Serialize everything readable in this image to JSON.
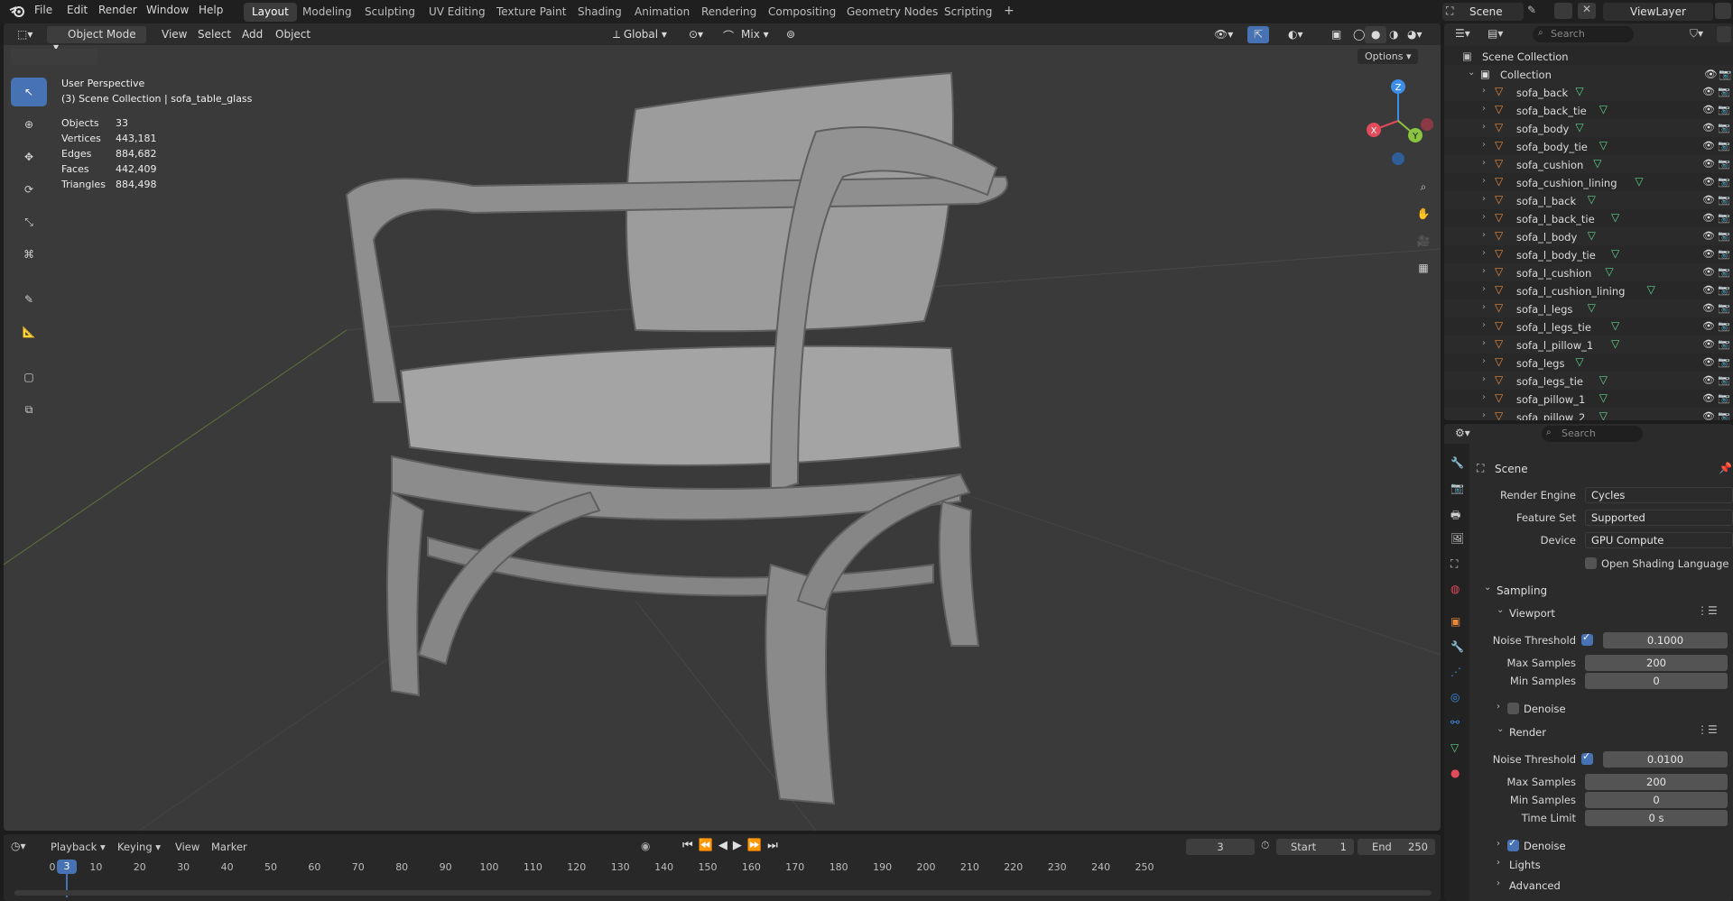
{
  "menubar": {
    "menus": [
      "File",
      "Edit",
      "Render",
      "Window",
      "Help"
    ],
    "workspaces": [
      "Layout",
      "Modeling",
      "Sculpting",
      "UV Editing",
      "Texture Paint",
      "Shading",
      "Animation",
      "Rendering",
      "Compositing",
      "Geometry Nodes",
      "Scripting"
    ],
    "active_workspace": "Layout",
    "add_tab": "+",
    "scene": "Scene",
    "view_layer": "ViewLayer"
  },
  "viewport_header": {
    "mode": "Object Mode",
    "menus": [
      "View",
      "Select",
      "Add",
      "Object"
    ],
    "orientation": "Global",
    "pivot": "Mix",
    "options": "Options"
  },
  "viewport_overlay": {
    "view_name": "User Perspective",
    "context": "(3) Scene Collection | sofa_table_glass",
    "stats": [
      {
        "label": "Objects",
        "value": "33"
      },
      {
        "label": "Vertices",
        "value": "443,181"
      },
      {
        "label": "Edges",
        "value": "884,682"
      },
      {
        "label": "Faces",
        "value": "442,409"
      },
      {
        "label": "Triangles",
        "value": "884,498"
      }
    ],
    "gizmo": {
      "z": "Z",
      "y": "Y",
      "x": "X"
    }
  },
  "timeline": {
    "menus": [
      "Playback",
      "Keying",
      "View",
      "Marker"
    ],
    "current_frame": "3",
    "start_label": "Start",
    "start": "1",
    "end_label": "End",
    "end": "250",
    "ticks": [
      "0",
      "10",
      "20",
      "30",
      "40",
      "50",
      "60",
      "70",
      "80",
      "90",
      "100",
      "110",
      "120",
      "130",
      "140",
      "150",
      "160",
      "170",
      "180",
      "190",
      "200",
      "210",
      "220",
      "230",
      "240",
      "250"
    ]
  },
  "outliner": {
    "search_placeholder": "Search",
    "root": "Scene Collection",
    "collection": "Collection",
    "items": [
      "sofa_back",
      "sofa_back_tie",
      "sofa_body",
      "sofa_body_tie",
      "sofa_cushion",
      "sofa_cushion_lining",
      "sofa_l_back",
      "sofa_l_back_tie",
      "sofa_l_body",
      "sofa_l_body_tie",
      "sofa_l_cushion",
      "sofa_l_cushion_lining",
      "sofa_l_legs",
      "sofa_l_legs_tie",
      "sofa_l_pillow_1",
      "sofa_legs",
      "sofa_legs_tie",
      "sofa_pillow_1",
      "sofa_pillow_2"
    ]
  },
  "properties": {
    "search_placeholder": "Search",
    "context": "Scene",
    "render_engine_label": "Render Engine",
    "render_engine": "Cycles",
    "feature_set_label": "Feature Set",
    "feature_set": "Supported",
    "device_label": "Device",
    "device": "GPU Compute",
    "osl_label": "Open Shading Language",
    "sampling": "Sampling",
    "viewport": "Viewport",
    "vp_noise_threshold_label": "Noise Threshold",
    "vp_noise_threshold": "0.1000",
    "vp_max_samples_label": "Max Samples",
    "vp_max_samples": "200",
    "vp_min_samples_label": "Min Samples",
    "vp_min_samples": "0",
    "vp_denoise": "Denoise",
    "render": "Render",
    "r_noise_threshold_label": "Noise Threshold",
    "r_noise_threshold": "0.0100",
    "r_max_samples_label": "Max Samples",
    "r_max_samples": "200",
    "r_min_samples_label": "Min Samples",
    "r_min_samples": "0",
    "r_time_limit_label": "Time Limit",
    "r_time_limit": "0 s",
    "r_denoise": "Denoise",
    "lights": "Lights",
    "advanced": "Advanced"
  },
  "colors": {
    "accent": "#4772b3",
    "mesh_icon": "#e8893a",
    "data_icon": "#5fd38a",
    "gizmo_x": "#e24b5a",
    "gizmo_y": "#8bc43f",
    "gizmo_z": "#3d8ee8"
  }
}
